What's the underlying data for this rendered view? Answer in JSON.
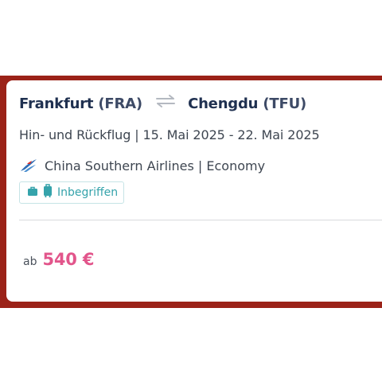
{
  "flight": {
    "origin_city": "Frankfurt",
    "origin_code": "(FRA)",
    "destination_city": "Chengdu",
    "destination_code": "(TFU)",
    "trip_info": "Hin- und Rückflug | 15. Mai 2025 - 22. Mai 2025",
    "airline_info": "China Southern Airlines | Economy",
    "airline_logo_icon": "china-southern-logo-icon",
    "baggage_icons": [
      "briefcase-icon",
      "suitcase-icon"
    ],
    "baggage_label": "Inbegriffen"
  },
  "price": {
    "prefix": "ab",
    "amount": "540 €"
  },
  "colors": {
    "accent_band": "#9b2218",
    "route_text": "#1f3050",
    "baggage": "#35a3ab",
    "price": "#e2558b"
  }
}
